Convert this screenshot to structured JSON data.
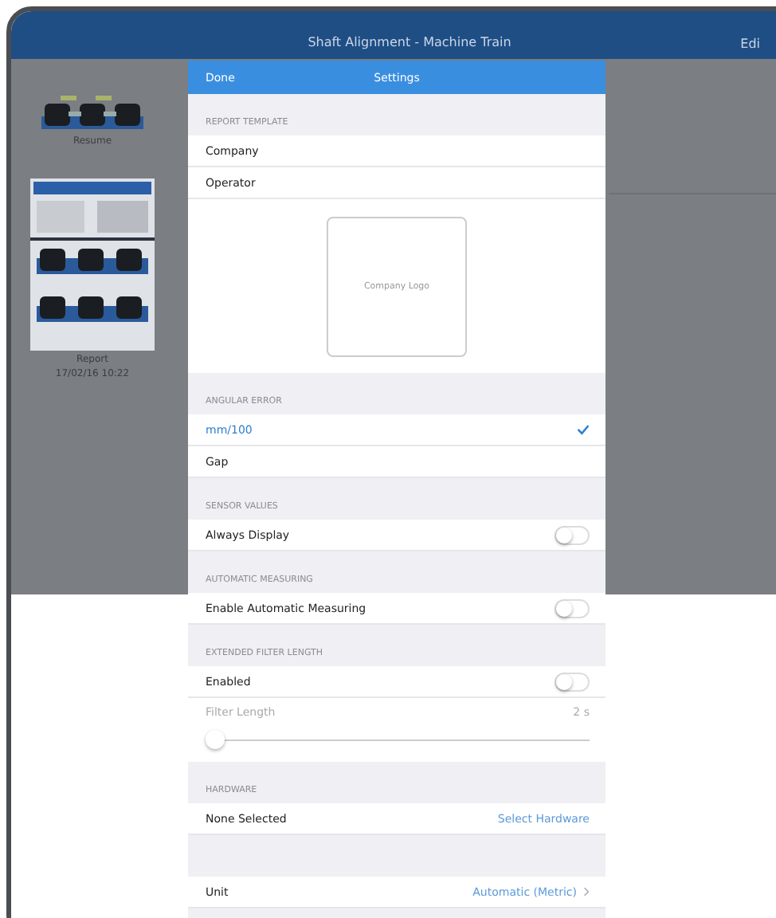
{
  "navbar": {
    "title": "Shaft Alignment - Machine Train",
    "action": "Edi"
  },
  "files": [
    {
      "kind": "machine",
      "label": "Resume"
    },
    {
      "kind": "report",
      "label": "Report",
      "date": "17/02/16 10:22"
    }
  ],
  "settings": {
    "done": "Done",
    "title": "Settings",
    "sections": [
      {
        "title": "REPORT TEMPLATE",
        "rows": [
          {
            "kind": "text",
            "label": "Company"
          },
          {
            "kind": "text",
            "label": "Operator"
          },
          {
            "kind": "logo",
            "label": "Company Logo"
          }
        ]
      },
      {
        "title": "ANGULAR ERROR",
        "rows": [
          {
            "kind": "choice",
            "label": "mm/100",
            "selected": true
          },
          {
            "kind": "choice",
            "label": "Gap",
            "selected": false
          }
        ]
      },
      {
        "title": "SENSOR VALUES",
        "rows": [
          {
            "kind": "toggle",
            "label": "Always Display",
            "on": false
          }
        ]
      },
      {
        "title": "AUTOMATIC MEASURING",
        "rows": [
          {
            "kind": "toggle",
            "label": "Enable Automatic Measuring",
            "on": false
          }
        ]
      },
      {
        "title": "EXTENDED FILTER LENGTH",
        "rows": [
          {
            "kind": "toggle",
            "label": "Enabled",
            "on": false
          },
          {
            "kind": "slider",
            "label": "Filter Length",
            "value": "2 s",
            "level": 0,
            "disabled": true
          }
        ]
      },
      {
        "title": "HARDWARE",
        "rows": [
          {
            "kind": "link",
            "label": "None Selected",
            "value": "Select Hardware"
          }
        ]
      },
      {
        "rows": [
          {
            "kind": "link",
            "label": "Unit",
            "value": "Automatic (Metric)",
            "chevron": true
          }
        ]
      }
    ]
  }
}
